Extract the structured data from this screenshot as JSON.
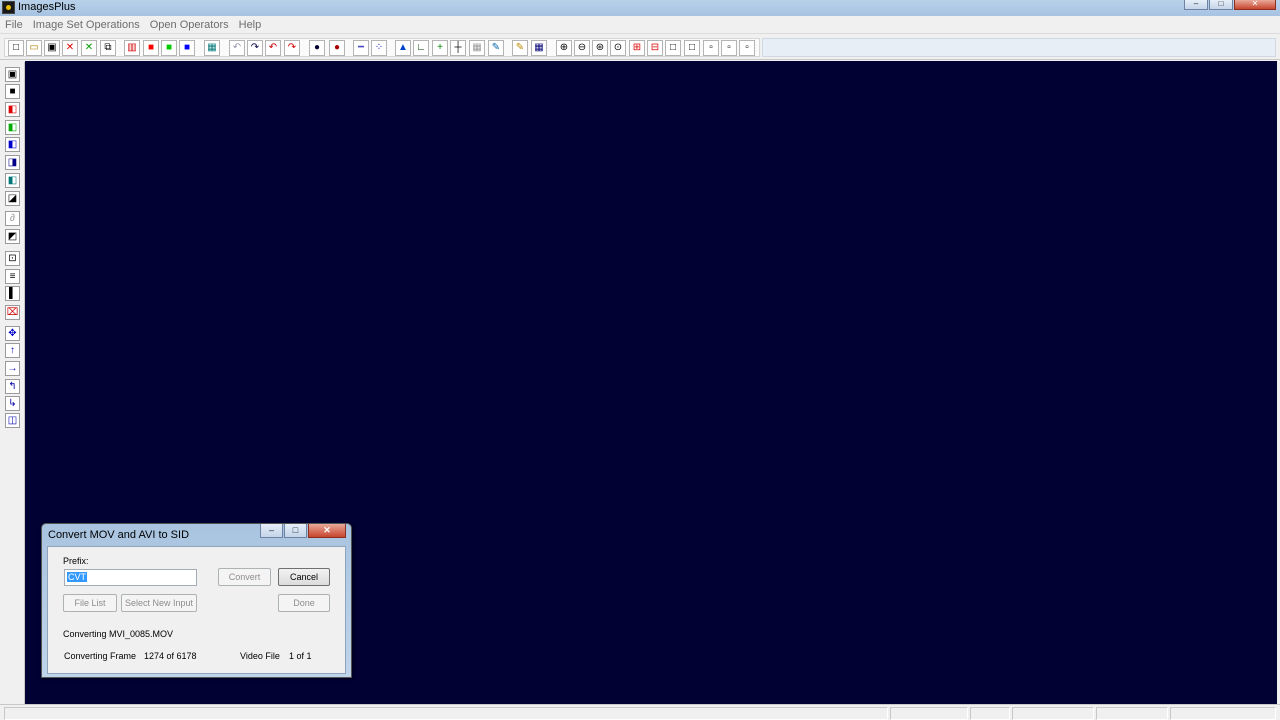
{
  "window": {
    "title": "ImagesPlus",
    "minimize": "–",
    "maximize": "□",
    "close": "✕"
  },
  "menu": [
    "File",
    "Image Set Operations",
    "Open Operators",
    "Help"
  ],
  "toolbar_icons": [
    "new-file-icon",
    "open-file-icon",
    "save-icon",
    "close-red-x-icon",
    "close-green-x-icon",
    "copy-icon",
    "rgb-channels-icon",
    "red-channel-icon",
    "green-channel-icon",
    "blue-channel-icon",
    "grid-icon",
    "undo-icon",
    "redo-icon",
    "undo-red-icon",
    "redo-red-icon",
    "circle-select-icon",
    "red-circle-icon",
    "dotted-line-icon",
    "dotted-path-icon",
    "histogram-icon",
    "axes-icon",
    "green-cross-icon",
    "crosshair-icon",
    "grid-select-icon",
    "paint-icon",
    "pencil-icon",
    "grid-fill-icon",
    "zoom-in-icon",
    "zoom-out-icon",
    "zoom-fit-icon",
    "zoom-actual-icon",
    "red-plus-icon",
    "red-minus-icon",
    "square-large-icon",
    "square-medium-icon",
    "square-small-icon",
    "square-tiny-icon",
    "square-min-icon"
  ],
  "left_tools": [
    "save-icon",
    "black-icon",
    "red-black-icon",
    "green-black-icon",
    "blue-black-icon",
    "blue-alt-icon",
    "cyan-icon",
    "black-corner-icon",
    "script-icon",
    "slash-icon",
    "target-icon",
    "align-icon",
    "black-bar-icon",
    "select-red-icon",
    "move-icon",
    "up-arrow-icon",
    "right-arrow-icon",
    "rotate-left-icon",
    "rotate-right-icon",
    "mirror-icon"
  ],
  "dialog": {
    "title": "Convert MOV and AVI to SID",
    "prefix_label": "Prefix:",
    "prefix_value": "CVT",
    "convert_button": "Convert",
    "cancel_button": "Cancel",
    "file_list_button": "File List",
    "select_new_input_button": "Select New Input",
    "done_button": "Done",
    "converting_text": "Converting MVI_0085.MOV",
    "frame_label": "Converting Frame",
    "frame_value": "1274 of 6178",
    "video_file_label": "Video File",
    "video_file_value": "1 of 1"
  },
  "colors": {
    "workspace": "#010133",
    "title_bar": "#b9d1ea"
  }
}
